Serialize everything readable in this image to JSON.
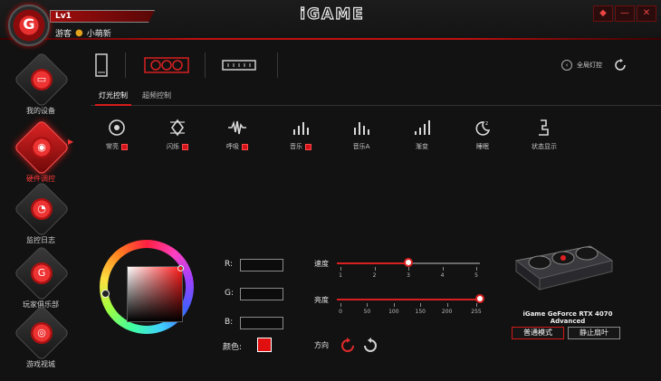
{
  "titlebar": {
    "level": "Lv1",
    "user_prefix": "游客",
    "username": "小萌新",
    "logo": "iGAME",
    "window_buttons": [
      "skin-icon",
      "minimize-icon",
      "close-icon"
    ]
  },
  "sidebar": {
    "items": [
      {
        "label": "我的设备",
        "icon": "monitor-icon",
        "active": false
      },
      {
        "label": "硬件调控",
        "icon": "control-icon",
        "active": true
      },
      {
        "label": "监控日志",
        "icon": "gauge-icon",
        "active": false
      },
      {
        "label": "玩家俱乐部",
        "icon": "club-icon",
        "active": false
      },
      {
        "label": "游戏视城",
        "icon": "gamepad-icon",
        "active": false
      }
    ]
  },
  "devices": {
    "items": [
      "pc-case-icon",
      "graphics-card-icon",
      "memory-icon"
    ],
    "global_light": "全局灯控"
  },
  "tabs": [
    {
      "label": "灯光控制",
      "active": true
    },
    {
      "label": "超频控制",
      "active": false
    }
  ],
  "effects": [
    {
      "label": "常亮",
      "icon": "static-icon",
      "has_color": true
    },
    {
      "label": "闪烁",
      "icon": "flash-icon",
      "has_color": true
    },
    {
      "label": "呼吸",
      "icon": "breath-icon",
      "has_color": true
    },
    {
      "label": "音乐",
      "icon": "music-icon",
      "has_color": true
    },
    {
      "label": "音乐A",
      "icon": "music-a-icon",
      "has_color": false
    },
    {
      "label": "渐变",
      "icon": "gradient-icon",
      "has_color": false
    },
    {
      "label": "睡眠",
      "icon": "sleep-icon",
      "has_color": false
    },
    {
      "label": "状态显示",
      "icon": "status-icon",
      "has_color": false
    }
  ],
  "color": {
    "r_label": "R:",
    "g_label": "G:",
    "b_label": "B:",
    "r_value": "",
    "g_value": "",
    "b_value": "",
    "label": "颜色:",
    "swatch": "#e01010"
  },
  "sliders": {
    "speed": {
      "label": "速度",
      "ticks": [
        "1",
        "2",
        "3",
        "4",
        "5"
      ],
      "value": 3,
      "min": 1,
      "max": 5
    },
    "brightness": {
      "label": "亮度",
      "ticks": [
        "0",
        "50",
        "100",
        "150",
        "200",
        "255"
      ],
      "value": 255,
      "min": 0,
      "max": 255
    }
  },
  "direction": {
    "label": "方向"
  },
  "card": {
    "name": "iGame GeForce RTX 4070 Advanced",
    "normal_mode": "普通模式",
    "stop_fan": "静止扇叶"
  },
  "colors": {
    "accent": "#d82020",
    "background": "#121212"
  }
}
